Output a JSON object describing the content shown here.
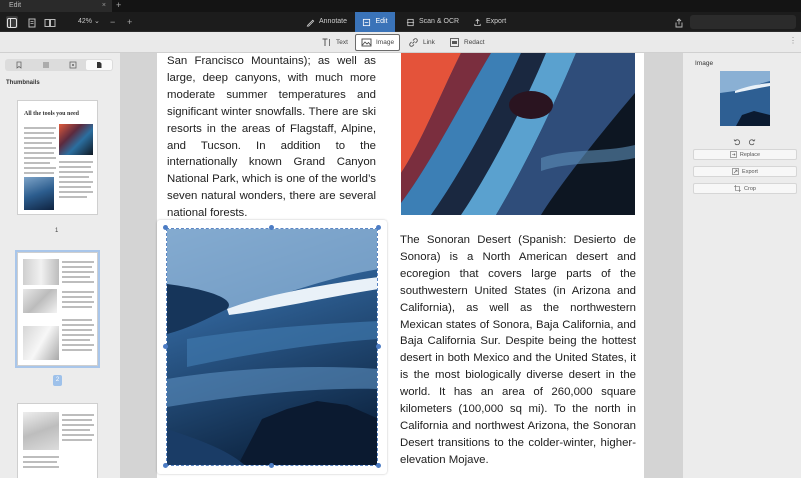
{
  "tab": {
    "title": "Edit",
    "close": "×",
    "new": "+"
  },
  "toolbar": {
    "zoom": "42% ⌄",
    "zoom_out": "−",
    "zoom_in": "+",
    "modes": [
      {
        "label": "Annotate",
        "icon": "annotate-icon",
        "active": false
      },
      {
        "label": "Edit",
        "icon": "edit-icon",
        "active": true
      },
      {
        "label": "Scan & OCR",
        "icon": "scan-icon",
        "active": false
      },
      {
        "label": "Export",
        "icon": "export-icon",
        "active": false
      }
    ]
  },
  "edit_tools": {
    "text": "Text",
    "image": "Image",
    "link": "Link",
    "redact": "Redact"
  },
  "left_panel": {
    "title": "Thumbnails",
    "thumb1_heading": "All the tools you need",
    "page_label_1": "1",
    "page_label_2": "2"
  },
  "document": {
    "left_column": "San Francisco Mountains); as well as large, deep canyons, with much more moderate summer temperatures and significant winter snowfalls. There are ski resorts in the areas of Flagstaff, Alpine, and Tucson. In addition to the internationally known Grand Canyon National Park, which is one of the world’s seven natural wonders, there are several national forests.",
    "right_column": "The Sonoran Desert (Spanish: Desierto de Sonora) is a North American desert and ecoregion that covers large parts of the southwestern United States (in Arizona and California), as well as the northwestern Mexican states of Sonora, Baja California, and Baja California Sur. Despite being the hottest desert in both Mexico and the United States, it is the most biologically diverse desert in the world. It has an area of 260,000 square kilometers (100,000 sq mi). To the north in California and northwest Arizona, the Sonoran Desert transitions to the colder-winter, higher-elevation Mojave."
  },
  "right_panel": {
    "title": "Image",
    "replace": "Replace",
    "export": "Export",
    "crop": "Crop"
  },
  "colors": {
    "accent": "#3a73b8",
    "selection_handle": "#4c7cc4"
  }
}
